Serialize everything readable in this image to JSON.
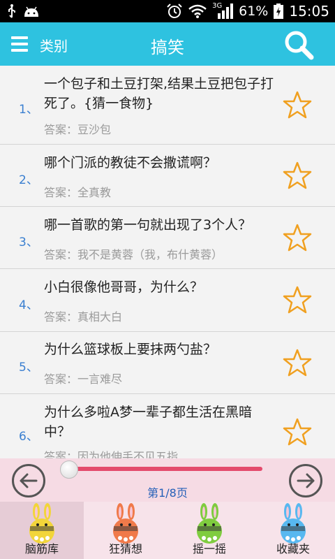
{
  "status_bar": {
    "network": "3G",
    "battery": "61%",
    "time": "15:05"
  },
  "header": {
    "category_label": "类别",
    "title": "搞笑"
  },
  "items": [
    {
      "number": "1、",
      "question": "一个包子和土豆打架,结果土豆把包子打死了。{猜一食物}",
      "answer": "答案：豆沙包"
    },
    {
      "number": "2、",
      "question": "哪个门派的教徒不会撒谎啊？",
      "answer": "答案：全真教"
    },
    {
      "number": "3、",
      "question": "哪一首歌的第一句就出现了3个人？",
      "answer": "答案：我不是黄蓉（我，布什黄蓉）"
    },
    {
      "number": "4、",
      "question": "小白很像他哥哥，为什么？",
      "answer": "答案：真相大白"
    },
    {
      "number": "5、",
      "question": "为什么篮球板上要抹两勺盐？",
      "answer": "答案：一言难尽"
    },
    {
      "number": "6、",
      "question": "为什么多啦A梦一辈子都生活在黑暗中？",
      "answer": "答案：因为他伸手不见五指"
    }
  ],
  "pager": {
    "page_indicator": "第1/8页",
    "progress_fraction": 0.0
  },
  "tabs": [
    {
      "label": "脑筋库",
      "active": true,
      "color": "#f2d53a"
    },
    {
      "label": "狂猜想",
      "active": false,
      "color": "#f07a4a"
    },
    {
      "label": "摇一摇",
      "active": false,
      "color": "#7fcc3f"
    },
    {
      "label": "收藏夹",
      "active": false,
      "color": "#58b8f0"
    }
  ],
  "colors": {
    "header_bg": "#2ec2e0",
    "number_blue": "#3a7fd0",
    "star_orange": "#f0a020",
    "slider_red": "#e44a6c"
  }
}
